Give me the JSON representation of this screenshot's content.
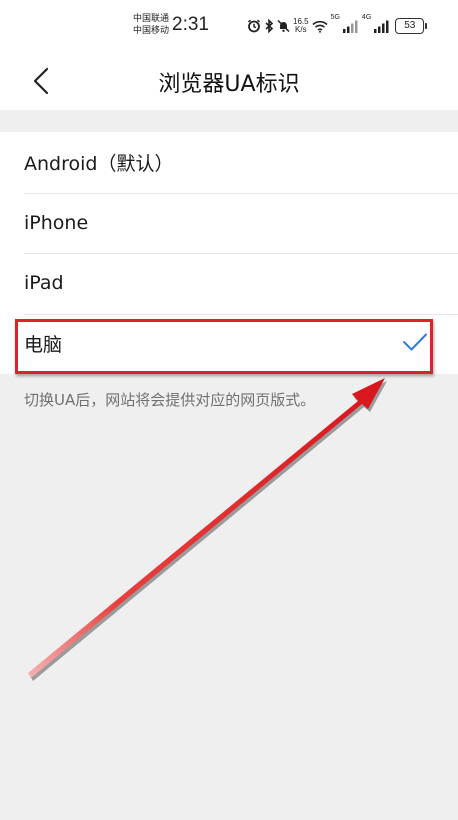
{
  "status_bar": {
    "carrier_1": "中国联通",
    "carrier_2": "中国移动",
    "time": "2:31",
    "net_speed_value": "16.5",
    "net_speed_unit": "K/s",
    "signal_1_label": "5G",
    "signal_2_label": "4G",
    "battery": "53",
    "icons": [
      "alarm-icon",
      "bluetooth-icon",
      "mute-icon",
      "wifi-icon",
      "signal-icon",
      "signal-icon",
      "battery-icon"
    ]
  },
  "header": {
    "title": "浏览器UA标识",
    "back_icon": "back-chevron-icon"
  },
  "options": [
    {
      "label": "Android（默认）",
      "selected": false
    },
    {
      "label": "iPhone",
      "selected": false
    },
    {
      "label": "iPad",
      "selected": false
    },
    {
      "label": "电脑",
      "selected": true
    }
  ],
  "hint": "切换UA后，网站将会提供对应的网页版式。",
  "colors": {
    "accent": "#2f7be0",
    "annotation": "#e0202a",
    "background": "#efefef"
  }
}
